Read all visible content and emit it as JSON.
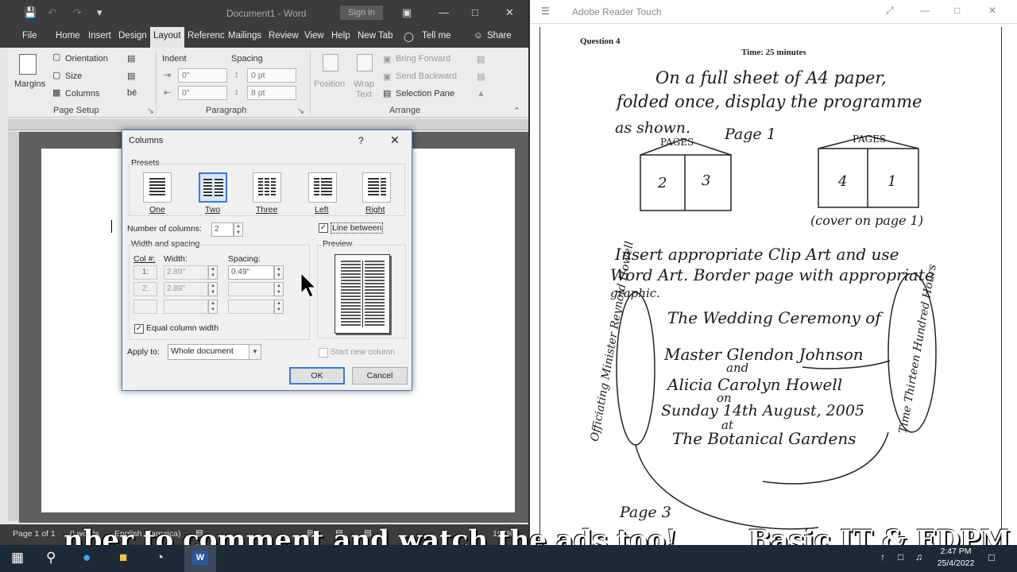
{
  "word": {
    "title": "Document1 - Word",
    "signin": "Sign in",
    "tabs": [
      "File",
      "Home",
      "Insert",
      "Design",
      "Layout",
      "Referenc",
      "Mailings",
      "Review",
      "View",
      "Help",
      "New Tab",
      "Tell me",
      "Share"
    ],
    "ribbon": {
      "margins": "Margins",
      "orientation": "Orientation",
      "size": "Size",
      "columns": "Columns",
      "page_setup": "Page Setup",
      "indent": "Indent",
      "spacing": "Spacing",
      "indent_left": "0\"",
      "indent_right": "0\"",
      "spacing_before": "0 pt",
      "spacing_after": "8 pt",
      "paragraph": "Paragraph",
      "position": "Position",
      "wrap_text": "Wrap Text",
      "bring_forward": "Bring Forward",
      "send_backward": "Send Backward",
      "selection_pane": "Selection Pane",
      "arrange": "Arrange"
    },
    "status": {
      "page": "Page 1 of 1",
      "words": "0 words",
      "language": "English (Jamaica)",
      "zoom": "100%"
    }
  },
  "dialog": {
    "title": "Columns",
    "help": "?",
    "presets_label": "Presets",
    "presets": [
      "One",
      "Two",
      "Three",
      "Left",
      "Right"
    ],
    "num_columns_label": "Number of columns:",
    "num_columns": "2",
    "line_between": "Line between",
    "width_spacing": "Width and spacing",
    "col_header": "Col #:",
    "width_header": "Width:",
    "spacing_header": "Spacing:",
    "row1_col": "1:",
    "row1_width": "2.89\"",
    "row1_spacing": "0.49\"",
    "row2_col": "2:",
    "row2_width": "2.89\"",
    "equal_width": "Equal column width",
    "preview": "Preview",
    "apply_to_label": "Apply to:",
    "apply_to": "Whole document",
    "start_new_column": "Start new column",
    "ok": "OK",
    "cancel": "Cancel"
  },
  "reader": {
    "title": "Adobe Reader Touch",
    "question": "Question 4",
    "time": "Time:  25 minutes",
    "line1": "On a full sheet of A4 paper,",
    "line2": "folded once, display the programme",
    "line3": "as shown.",
    "page1": "Page 1",
    "pages_a": "PAGES",
    "pages_b": "PAGES",
    "box2": "2",
    "box3": "3",
    "box4": "4",
    "box1": "1",
    "cover": "(cover on page 1)",
    "inst1": "Insert appropriate Clip Art and use",
    "inst2": "Word Art. Border page with appropriate",
    "inst3": "graphic.",
    "prog1": "The Wedding Ceremony of",
    "prog2": "Master Glendon Johnson",
    "prog3": "and",
    "prog4": "Alicia Carolyn Howell",
    "prog5": "on",
    "prog6": "Sunday 14th August, 2005",
    "prog7": "at",
    "prog8": "The Botanical Gardens",
    "side_left": "Officiating Minister Reynold Howell",
    "side_right": "Time Thirteen Hundred Hours",
    "page3": "Page 3"
  },
  "caption": {
    "left": "nber to comment and watch the ads too!",
    "right": "Basic IT & EDPM"
  },
  "taskbar": {
    "time": "2:47 PM",
    "date": "25/4/2022"
  }
}
